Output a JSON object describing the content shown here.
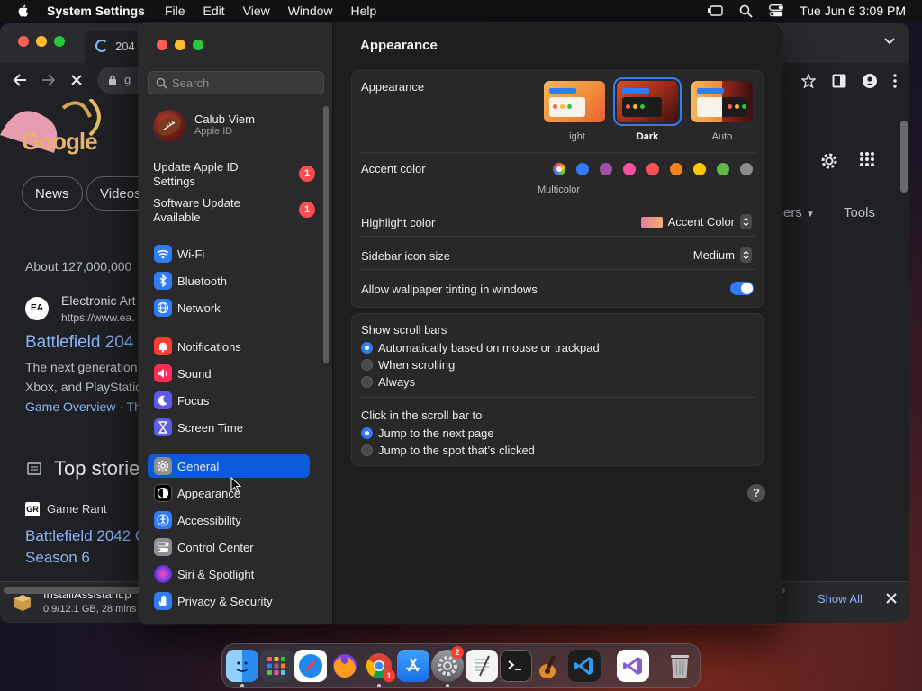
{
  "menubar": {
    "app_name": "System Settings",
    "items": [
      "File",
      "Edit",
      "View",
      "Window",
      "Help"
    ],
    "clock": "Tue Jun 6  3:09 PM"
  },
  "browser": {
    "tab_title": "204",
    "omnibox_text": "g",
    "logo_text": "Google",
    "chips": [
      "News",
      "Videos"
    ],
    "filters_label": "ers",
    "tools_label": "Tools",
    "results_count": "About 127,000,000",
    "result_site": "Electronic Art",
    "result_url": "https://www.ea.",
    "result_icon_text": "EA",
    "result_title": "Battlefield 204",
    "result_line_1": "The next generation",
    "result_line_2": "Xbox, and PlayStatio",
    "result_links": "Game Overview · The",
    "top_stories": "Top storie",
    "story_source": "Game Rant",
    "story_icon_text": "GR",
    "story_title_1": "Battlefield 2042 C",
    "story_title_2": "Season 6",
    "download_name": "InstallAssistant.p",
    "download_status": "0.9/12.1 GB, 28 mins l",
    "show_all": "Show All"
  },
  "settings": {
    "search_placeholder": "Search",
    "user": {
      "name": "Calub Viem",
      "sub": "Apple ID"
    },
    "notices": [
      {
        "label": "Update Apple ID Settings",
        "badge": "1"
      },
      {
        "label": "Software Update Available",
        "badge": "1"
      }
    ],
    "sidebar_items": [
      {
        "label": "Wi-Fi",
        "icon": "wifi-icon",
        "color": "#2f7cf6"
      },
      {
        "label": "Bluetooth",
        "icon": "bluetooth-icon",
        "color": "#2f7cf6"
      },
      {
        "label": "Network",
        "icon": "globe-icon",
        "color": "#2f7cf6"
      },
      {
        "label": "Notifications",
        "icon": "bell-icon",
        "color": "#ff3b30"
      },
      {
        "label": "Sound",
        "icon": "speaker-icon",
        "color": "#ff2d55"
      },
      {
        "label": "Focus",
        "icon": "moon-icon",
        "color": "#5e5ce6"
      },
      {
        "label": "Screen Time",
        "icon": "hourglass-icon",
        "color": "#5e5ce6"
      },
      {
        "label": "General",
        "icon": "gear-icon",
        "color": "#8e8e93"
      },
      {
        "label": "Appearance",
        "icon": "contrast-icon",
        "color": "#000000"
      },
      {
        "label": "Accessibility",
        "icon": "accessibility-icon",
        "color": "#2f7cf6"
      },
      {
        "label": "Control Center",
        "icon": "switches-icon",
        "color": "#8e8e93"
      },
      {
        "label": "Siri & Spotlight",
        "icon": "siri-icon",
        "color": "#7a3ff0"
      },
      {
        "label": "Privacy & Security",
        "icon": "hand-icon",
        "color": "#2f7cf6"
      }
    ],
    "selected_item": "General",
    "page_title": "Appearance",
    "appearance_label": "Appearance",
    "themes": [
      {
        "label": "Light",
        "selected": false
      },
      {
        "label": "Dark",
        "selected": true
      },
      {
        "label": "Auto",
        "selected": false
      }
    ],
    "accent_label": "Accent color",
    "accent_colors": [
      "multicolor",
      "#2f7cf6",
      "#a550a7",
      "#f74f9e",
      "#ff5257",
      "#f7821b",
      "#ffc600",
      "#62ba46",
      "#8c8c8c"
    ],
    "multicolor_label": "Multicolor",
    "highlight_label": "Highlight color",
    "highlight_value": "Accent Color",
    "icon_size_label": "Sidebar icon size",
    "icon_size_value": "Medium",
    "tinting_label": "Allow wallpaper tinting in windows",
    "tinting_on": true,
    "scrollbars_label": "Show scroll bars",
    "scrollbar_options": [
      {
        "label": "Automatically based on mouse or trackpad",
        "selected": true
      },
      {
        "label": "When scrolling",
        "selected": false
      },
      {
        "label": "Always",
        "selected": false
      }
    ],
    "click_label": "Click in the scroll bar to",
    "click_options": [
      {
        "label": "Jump to the next page",
        "selected": true
      },
      {
        "label": "Jump to the spot that’s clicked",
        "selected": false
      }
    ],
    "help_label": "?"
  },
  "dock": {
    "settings_badge": "2",
    "chrome_badge": "1"
  }
}
